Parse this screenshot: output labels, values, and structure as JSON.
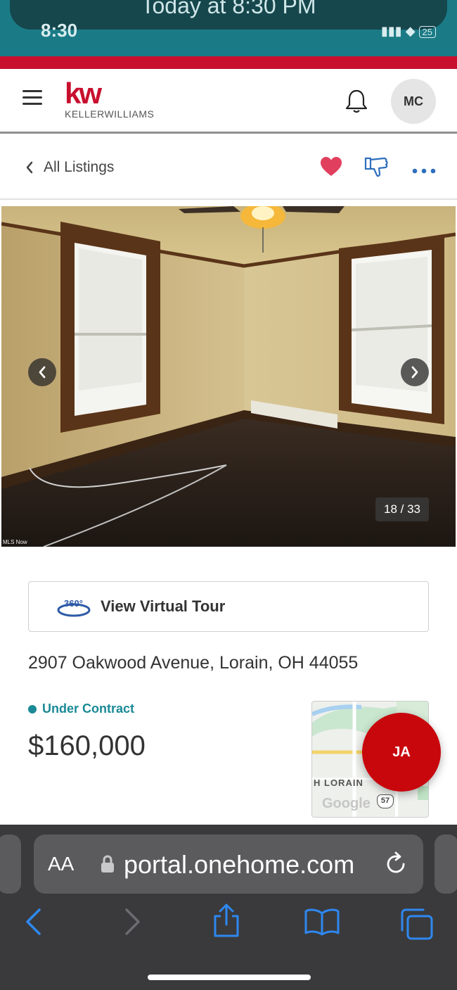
{
  "status_bar": {
    "notification_text": "Today at 8:30 PM",
    "time": "8:30",
    "battery": "25"
  },
  "header": {
    "logo_mark": "kw",
    "logo_word": "KELLERWILLIAMS",
    "avatar_initials": "MC"
  },
  "listing_nav": {
    "back_label": "All Listings"
  },
  "photo": {
    "counter": "18 / 33",
    "credit": "MLS Now"
  },
  "tour": {
    "icon_text": "360°",
    "label": "View Virtual Tour"
  },
  "listing": {
    "address": "2907 Oakwood Avenue,  Lorain, OH 44055",
    "status": "Under Contract",
    "price": "$160,000"
  },
  "map": {
    "label": "H LORAIN",
    "brand": "Google",
    "route": "57"
  },
  "fab": {
    "initials": "JA"
  },
  "safari": {
    "aa": "AA",
    "url": "portal.onehome.com"
  },
  "colors": {
    "brand_red": "#c8102e",
    "status_teal": "#1a8a96",
    "heart": "#e0405e",
    "safari_bg": "#3a3a3c",
    "link_blue": "#2e88f0"
  }
}
